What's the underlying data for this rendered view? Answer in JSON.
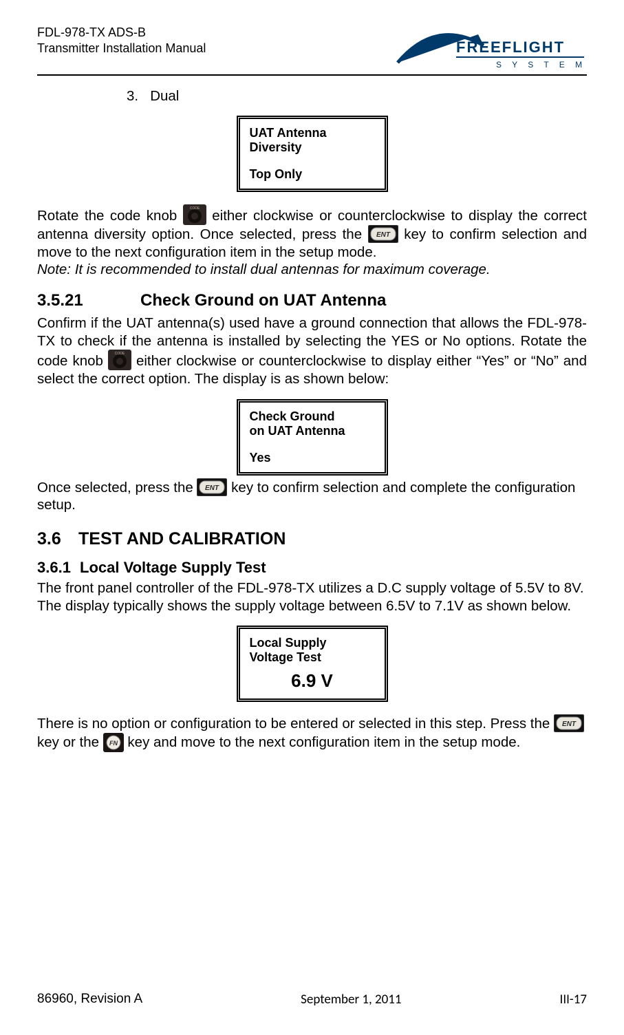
{
  "header": {
    "line1": "FDL-978-TX ADS-B",
    "line2": "Transmitter Installation Manual",
    "brand_top": "FREEFLIGHT",
    "brand_bottom": "S Y S T E M S"
  },
  "list": {
    "num": "3.",
    "label": "Dual"
  },
  "box1": {
    "l1": "UAT Antenna",
    "l2": "Diversity",
    "l3": "Top Only"
  },
  "para1_a": "Rotate the code knob ",
  "para1_b": " either clockwise or counterclockwise to display the correct antenna diversity option. Once selected, press the  ",
  "para1_c": " key to confirm selection and move to the next configuration item in the setup mode.",
  "note1": "Note: It is recommended to install dual antennas for maximum coverage.",
  "sec_3_5_21": {
    "num": "3.5.21",
    "title": "Check Ground on UAT Antenna"
  },
  "para2_a": "Confirm if the UAT antenna(s) used have a ground connection that allows the FDL-978-TX to check if the antenna is installed by selecting the YES or No options. Rotate the code knob ",
  "para2_b": " either clockwise or counterclockwise to display either “Yes” or “No” and select the correct option. The display is as shown below:",
  "box2": {
    "l1": "Check Ground",
    "l2": "on UAT Antenna",
    "l3": "Yes"
  },
  "para3_a": "Once selected, press the  ",
  "para3_b": " key to confirm selection and complete the configuration setup.",
  "sec_3_6": {
    "num": "3.6",
    "title": "TEST AND CALIBRATION"
  },
  "sec_3_6_1": {
    "num": "3.6.1",
    "title": "Local Voltage Supply Test"
  },
  "para4": "The front panel controller of the FDL-978-TX utilizes a D.C supply voltage of 5.5V to 8V. The display typically shows the supply voltage between 6.5V to 7.1V as shown below.",
  "box3": {
    "l1": "Local Supply",
    "l2": "Voltage Test",
    "value": "6.9 V"
  },
  "para5_a": "There is no option or configuration to be entered or selected in this step. Press the  ",
  "para5_b": " key or the ",
  "para5_c": " key and move to the next configuration item in the setup mode.",
  "footer": {
    "left": "86960, Revision A",
    "mid": "September 1, 2011",
    "right": "III-17"
  },
  "icons": {
    "knob_label": "CODE",
    "ent_label": "ENT",
    "fn_label": "FN"
  }
}
